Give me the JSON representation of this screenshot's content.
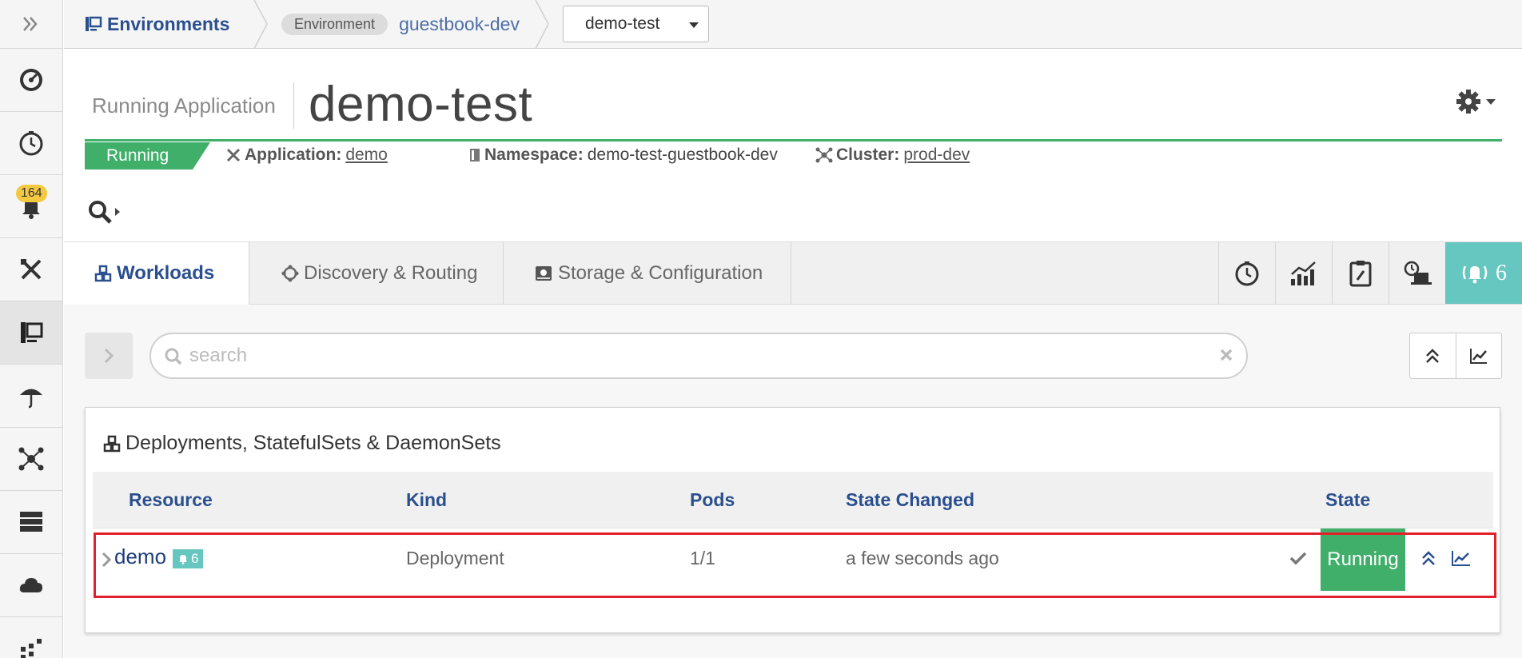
{
  "sidebar": {
    "badge_count": "164",
    "items": [
      "expand-icon",
      "dashboard-icon",
      "history-icon",
      "alerts-icon",
      "tools-icon",
      "environments-icon",
      "helm-icon",
      "cluster-icon",
      "storage-icon",
      "cloud-icon",
      "more-icon"
    ]
  },
  "breadcrumb": {
    "environments_label": "Environments",
    "environment_tag": "Environment",
    "environment_name": "guestbook-dev",
    "namespace_select": "demo-test"
  },
  "header": {
    "subtitle": "Running Application",
    "title": "demo-test",
    "status": "Running",
    "application_label": "Application:",
    "application_value": "demo",
    "namespace_label": "Namespace:",
    "namespace_value": "demo-test-guestbook-dev",
    "cluster_label": "Cluster:",
    "cluster_value": "prod-dev"
  },
  "tabs": [
    {
      "label": "Workloads",
      "active": true
    },
    {
      "label": "Discovery & Routing",
      "active": false
    },
    {
      "label": "Storage & Configuration",
      "active": false
    }
  ],
  "alerts_count": "6",
  "search": {
    "placeholder": "search",
    "value": ""
  },
  "panel": {
    "title": "Deployments, StatefulSets & DaemonSets",
    "columns": [
      "Resource",
      "Kind",
      "Pods",
      "State Changed",
      "State"
    ],
    "rows": [
      {
        "resource": "demo",
        "alerts": "6",
        "kind": "Deployment",
        "pods": "1/1",
        "state_changed": "a few seconds ago",
        "state": "Running"
      }
    ]
  },
  "colors": {
    "accent": "#2a4f8f",
    "running": "#3faf6a",
    "alert": "#66c6c0",
    "badge": "#f5c842",
    "highlight": "#e0202a"
  }
}
